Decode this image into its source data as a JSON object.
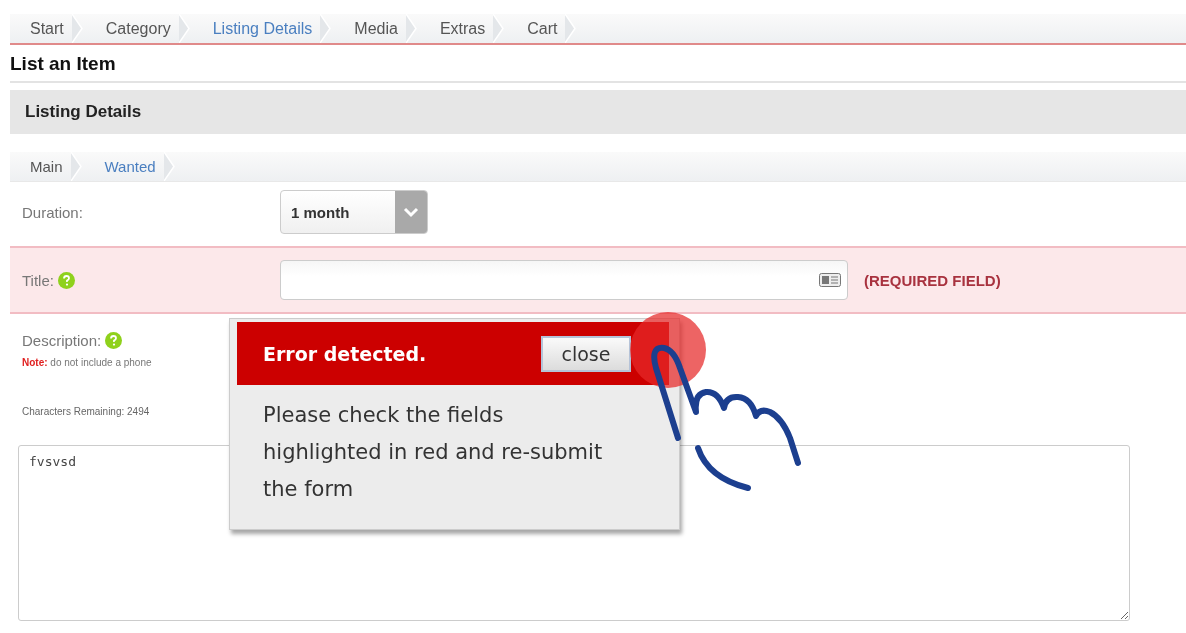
{
  "steps": [
    {
      "label": "Start",
      "selected": false
    },
    {
      "label": "Category",
      "selected": false
    },
    {
      "label": "Listing Details",
      "selected": true
    },
    {
      "label": "Media",
      "selected": false
    },
    {
      "label": "Extras",
      "selected": false
    },
    {
      "label": "Cart",
      "selected": false
    }
  ],
  "page_title": "List an Item",
  "section_title": "Listing Details",
  "sub_steps": [
    {
      "label": "Main",
      "selected": false
    },
    {
      "label": "Wanted",
      "selected": true
    }
  ],
  "duration": {
    "label": "Duration:",
    "value": "1 month"
  },
  "title_field": {
    "label": "Title:",
    "error": true,
    "error_text": "(REQUIRED FIELD)"
  },
  "description": {
    "label": "Description:",
    "note_label": "Note:",
    "note_text": "do not include a phone",
    "remaining": "Characters Remaining: 2494",
    "value": "fvsvsd"
  },
  "error_popup": {
    "title": "Error detected.",
    "close_label": "close",
    "message": "Please check the fields highlighted in red and re-submit the form"
  }
}
